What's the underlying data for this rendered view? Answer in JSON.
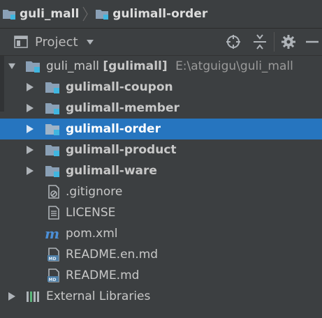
{
  "breadcrumb": {
    "root": "guli_mall",
    "current": "gulimall-order"
  },
  "toolwindow": {
    "title": "Project"
  },
  "tree": {
    "root_name": "guli_mall",
    "root_module": "[gulimall]",
    "root_path": "E:\\atguigu\\guli_mall",
    "modules": [
      "gulimall-coupon",
      "gulimall-member",
      "gulimall-order",
      "gulimall-product",
      "gulimall-ware"
    ],
    "selected_module": "gulimall-order",
    "files": [
      ".gitignore",
      "LICENSE",
      "pom.xml",
      "README.en.md",
      "README.md"
    ],
    "external": "External Libraries"
  },
  "colors": {
    "background": "#3c3f41",
    "selection": "#2675bf",
    "folder": "#8aa0b6",
    "module_badge": "#40b6e0",
    "maven": "#4c8fd6"
  },
  "icons": {
    "module": "module-folder-icon",
    "gitignore": "gitignore-file-icon",
    "license": "text-file-icon",
    "pom": "maven-icon",
    "markdown": "markdown-file-icon",
    "libraries": "libraries-icon"
  }
}
